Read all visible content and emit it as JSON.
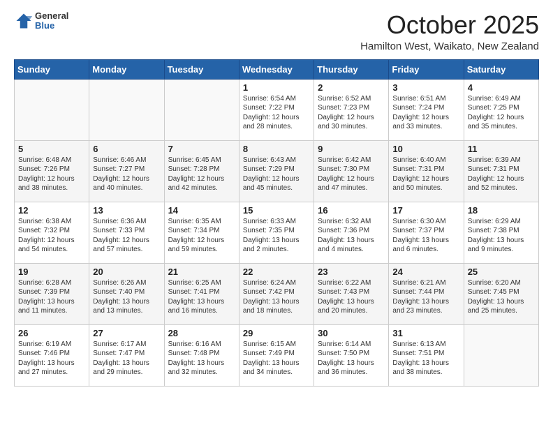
{
  "header": {
    "logo_general": "General",
    "logo_blue": "Blue",
    "month": "October 2025",
    "location": "Hamilton West, Waikato, New Zealand"
  },
  "weekdays": [
    "Sunday",
    "Monday",
    "Tuesday",
    "Wednesday",
    "Thursday",
    "Friday",
    "Saturday"
  ],
  "weeks": [
    [
      {
        "day": "",
        "info": ""
      },
      {
        "day": "",
        "info": ""
      },
      {
        "day": "",
        "info": ""
      },
      {
        "day": "1",
        "info": "Sunrise: 6:54 AM\nSunset: 7:22 PM\nDaylight: 12 hours\nand 28 minutes."
      },
      {
        "day": "2",
        "info": "Sunrise: 6:52 AM\nSunset: 7:23 PM\nDaylight: 12 hours\nand 30 minutes."
      },
      {
        "day": "3",
        "info": "Sunrise: 6:51 AM\nSunset: 7:24 PM\nDaylight: 12 hours\nand 33 minutes."
      },
      {
        "day": "4",
        "info": "Sunrise: 6:49 AM\nSunset: 7:25 PM\nDaylight: 12 hours\nand 35 minutes."
      }
    ],
    [
      {
        "day": "5",
        "info": "Sunrise: 6:48 AM\nSunset: 7:26 PM\nDaylight: 12 hours\nand 38 minutes."
      },
      {
        "day": "6",
        "info": "Sunrise: 6:46 AM\nSunset: 7:27 PM\nDaylight: 12 hours\nand 40 minutes."
      },
      {
        "day": "7",
        "info": "Sunrise: 6:45 AM\nSunset: 7:28 PM\nDaylight: 12 hours\nand 42 minutes."
      },
      {
        "day": "8",
        "info": "Sunrise: 6:43 AM\nSunset: 7:29 PM\nDaylight: 12 hours\nand 45 minutes."
      },
      {
        "day": "9",
        "info": "Sunrise: 6:42 AM\nSunset: 7:30 PM\nDaylight: 12 hours\nand 47 minutes."
      },
      {
        "day": "10",
        "info": "Sunrise: 6:40 AM\nSunset: 7:31 PM\nDaylight: 12 hours\nand 50 minutes."
      },
      {
        "day": "11",
        "info": "Sunrise: 6:39 AM\nSunset: 7:31 PM\nDaylight: 12 hours\nand 52 minutes."
      }
    ],
    [
      {
        "day": "12",
        "info": "Sunrise: 6:38 AM\nSunset: 7:32 PM\nDaylight: 12 hours\nand 54 minutes."
      },
      {
        "day": "13",
        "info": "Sunrise: 6:36 AM\nSunset: 7:33 PM\nDaylight: 12 hours\nand 57 minutes."
      },
      {
        "day": "14",
        "info": "Sunrise: 6:35 AM\nSunset: 7:34 PM\nDaylight: 12 hours\nand 59 minutes."
      },
      {
        "day": "15",
        "info": "Sunrise: 6:33 AM\nSunset: 7:35 PM\nDaylight: 13 hours\nand 2 minutes."
      },
      {
        "day": "16",
        "info": "Sunrise: 6:32 AM\nSunset: 7:36 PM\nDaylight: 13 hours\nand 4 minutes."
      },
      {
        "day": "17",
        "info": "Sunrise: 6:30 AM\nSunset: 7:37 PM\nDaylight: 13 hours\nand 6 minutes."
      },
      {
        "day": "18",
        "info": "Sunrise: 6:29 AM\nSunset: 7:38 PM\nDaylight: 13 hours\nand 9 minutes."
      }
    ],
    [
      {
        "day": "19",
        "info": "Sunrise: 6:28 AM\nSunset: 7:39 PM\nDaylight: 13 hours\nand 11 minutes."
      },
      {
        "day": "20",
        "info": "Sunrise: 6:26 AM\nSunset: 7:40 PM\nDaylight: 13 hours\nand 13 minutes."
      },
      {
        "day": "21",
        "info": "Sunrise: 6:25 AM\nSunset: 7:41 PM\nDaylight: 13 hours\nand 16 minutes."
      },
      {
        "day": "22",
        "info": "Sunrise: 6:24 AM\nSunset: 7:42 PM\nDaylight: 13 hours\nand 18 minutes."
      },
      {
        "day": "23",
        "info": "Sunrise: 6:22 AM\nSunset: 7:43 PM\nDaylight: 13 hours\nand 20 minutes."
      },
      {
        "day": "24",
        "info": "Sunrise: 6:21 AM\nSunset: 7:44 PM\nDaylight: 13 hours\nand 23 minutes."
      },
      {
        "day": "25",
        "info": "Sunrise: 6:20 AM\nSunset: 7:45 PM\nDaylight: 13 hours\nand 25 minutes."
      }
    ],
    [
      {
        "day": "26",
        "info": "Sunrise: 6:19 AM\nSunset: 7:46 PM\nDaylight: 13 hours\nand 27 minutes."
      },
      {
        "day": "27",
        "info": "Sunrise: 6:17 AM\nSunset: 7:47 PM\nDaylight: 13 hours\nand 29 minutes."
      },
      {
        "day": "28",
        "info": "Sunrise: 6:16 AM\nSunset: 7:48 PM\nDaylight: 13 hours\nand 32 minutes."
      },
      {
        "day": "29",
        "info": "Sunrise: 6:15 AM\nSunset: 7:49 PM\nDaylight: 13 hours\nand 34 minutes."
      },
      {
        "day": "30",
        "info": "Sunrise: 6:14 AM\nSunset: 7:50 PM\nDaylight: 13 hours\nand 36 minutes."
      },
      {
        "day": "31",
        "info": "Sunrise: 6:13 AM\nSunset: 7:51 PM\nDaylight: 13 hours\nand 38 minutes."
      },
      {
        "day": "",
        "info": ""
      }
    ]
  ]
}
